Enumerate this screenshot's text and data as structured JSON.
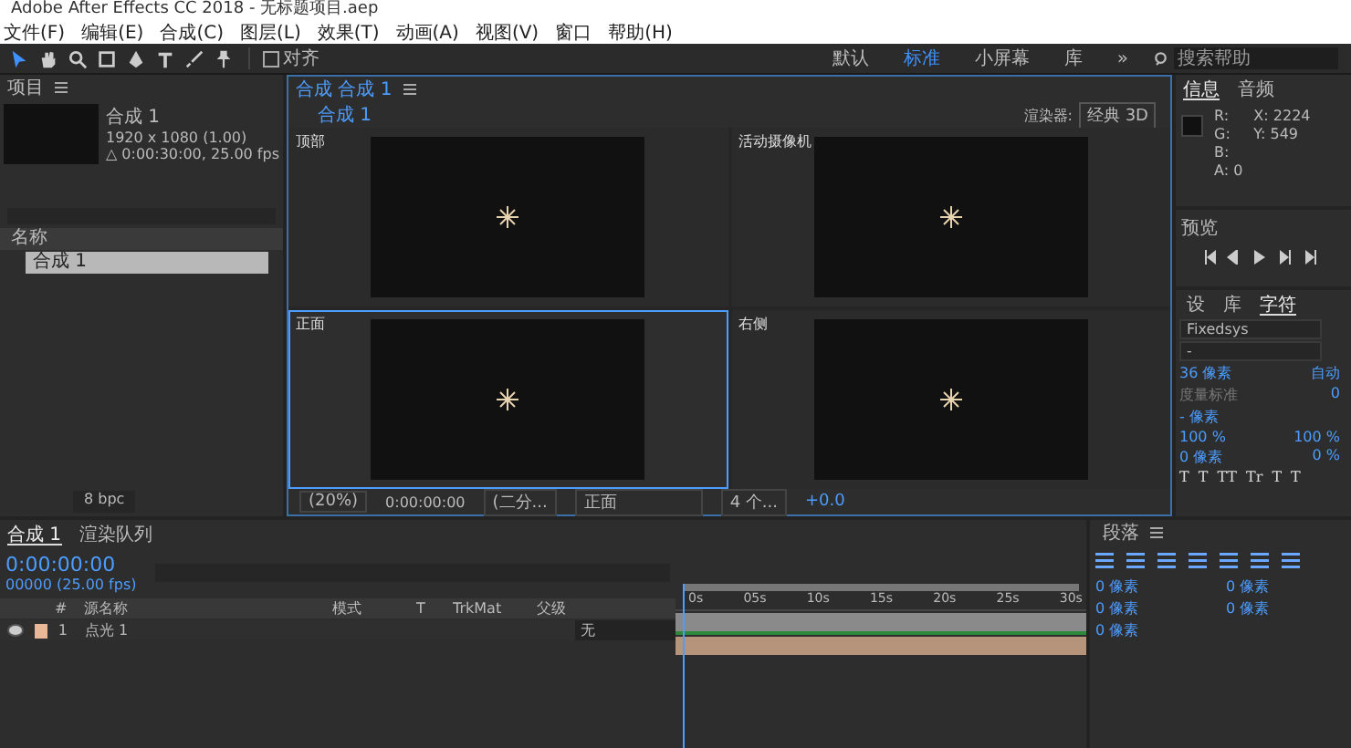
{
  "window": {
    "title": "Adobe After Effects CC 2018 - 无标题项目.aep"
  },
  "menu": [
    "文件(F)",
    "编辑(E)",
    "合成(C)",
    "图层(L)",
    "效果(T)",
    "动画(A)",
    "视图(V)",
    "窗口",
    "帮助(H)"
  ],
  "toolbar": {
    "tools": [
      {
        "kind": "select",
        "selected": true
      },
      {
        "kind": "hand",
        "selected": false
      },
      {
        "kind": "zoom",
        "selected": false
      },
      {
        "kind": "rect",
        "selected": false
      },
      {
        "kind": "pen",
        "selected": false
      },
      {
        "kind": "text",
        "selected": false
      },
      {
        "kind": "brush",
        "selected": false
      },
      {
        "kind": "pin",
        "selected": false
      }
    ],
    "snap": {
      "label": "对齐",
      "checked": false
    },
    "workspaces": [
      {
        "label": "默认",
        "selected": false
      },
      {
        "label": "标准",
        "selected": true
      },
      {
        "label": "小屏幕",
        "selected": false
      },
      {
        "label": "库",
        "selected": false
      }
    ],
    "more": "»",
    "search": {
      "placeholder": "搜索帮助"
    }
  },
  "project": {
    "title": "项目",
    "comp_name": "合成 1",
    "resolution": "1920 x 1080 (1.00)",
    "duration": "△ 0:00:30:00, 25.00 fps",
    "column": "名称",
    "items": [
      {
        "name": "合成 1",
        "selected": true
      }
    ],
    "depth": "8 bpc"
  },
  "composition": {
    "tab": "合成 合成 1",
    "breadcrumb": "合成 1",
    "renderer_label": "渲染器:",
    "renderer": "经典 3D",
    "views": [
      {
        "label": "顶部",
        "active": false
      },
      {
        "label": "活动摄像机",
        "active": false
      },
      {
        "label": "正面",
        "active": true
      },
      {
        "label": "右侧",
        "active": false
      }
    ],
    "zoom": "(20%)",
    "time": "0:00:00:00",
    "resolution": "(二分...",
    "view": "正面",
    "layout": "4 个...",
    "exposure": "+0.0"
  },
  "info": {
    "tabs": [
      {
        "label": "信息",
        "selected": true
      },
      {
        "label": "音频",
        "selected": false
      }
    ],
    "channels": [
      "R:",
      "G:",
      "B:",
      "A: 0"
    ],
    "coords": [
      "X: 2224",
      "Y: 549"
    ]
  },
  "preview": {
    "title": "预览"
  },
  "character": {
    "tabs": [
      {
        "label": "设",
        "selected": false
      },
      {
        "label": "库",
        "selected": false
      },
      {
        "label": "字符",
        "selected": true
      }
    ],
    "font": "Fixedsys",
    "style": "-",
    "size": "36 像素",
    "leading": "自动",
    "kerning": "度量标准",
    "tracking": "0",
    "stroke": "- 像素",
    "vscale": "100 %",
    "hscale": "100 %",
    "baseline": "0 像素",
    "tsume": "0 %",
    "styles": [
      "T",
      "T",
      "TT",
      "Tr",
      "T",
      "T"
    ]
  },
  "timeline": {
    "tabs": [
      {
        "label": "合成 1",
        "selected": true
      },
      {
        "label": "渲染队列",
        "selected": false
      }
    ],
    "timecode": "0:00:00:00",
    "frames": "00000 (25.00 fps)",
    "columns": [
      "#",
      "源名称",
      "模式",
      "T",
      "TrkMat",
      "父级"
    ],
    "layers": [
      {
        "index": "1",
        "name": "点光 1",
        "parent": "无",
        "visible": true,
        "color": "#e8b898"
      }
    ],
    "ruler": [
      "0s",
      "05s",
      "10s",
      "15s",
      "20s",
      "25s",
      "30s"
    ]
  },
  "paragraph": {
    "title": "段落",
    "indents": [
      "0 像素",
      "0 像素",
      "0 像素",
      "0 像素",
      "0 像素"
    ]
  }
}
